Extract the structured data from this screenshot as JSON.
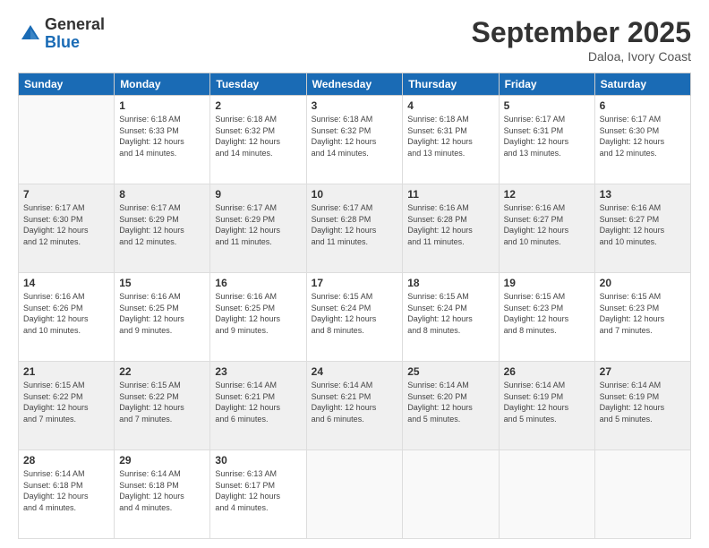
{
  "logo": {
    "general": "General",
    "blue": "Blue"
  },
  "header": {
    "title": "September 2025",
    "location": "Daloa, Ivory Coast"
  },
  "weekdays": [
    "Sunday",
    "Monday",
    "Tuesday",
    "Wednesday",
    "Thursday",
    "Friday",
    "Saturday"
  ],
  "weeks": [
    [
      {
        "day": "",
        "info": ""
      },
      {
        "day": "1",
        "info": "Sunrise: 6:18 AM\nSunset: 6:33 PM\nDaylight: 12 hours\nand 14 minutes."
      },
      {
        "day": "2",
        "info": "Sunrise: 6:18 AM\nSunset: 6:32 PM\nDaylight: 12 hours\nand 14 minutes."
      },
      {
        "day": "3",
        "info": "Sunrise: 6:18 AM\nSunset: 6:32 PM\nDaylight: 12 hours\nand 14 minutes."
      },
      {
        "day": "4",
        "info": "Sunrise: 6:18 AM\nSunset: 6:31 PM\nDaylight: 12 hours\nand 13 minutes."
      },
      {
        "day": "5",
        "info": "Sunrise: 6:17 AM\nSunset: 6:31 PM\nDaylight: 12 hours\nand 13 minutes."
      },
      {
        "day": "6",
        "info": "Sunrise: 6:17 AM\nSunset: 6:30 PM\nDaylight: 12 hours\nand 12 minutes."
      }
    ],
    [
      {
        "day": "7",
        "info": "Sunrise: 6:17 AM\nSunset: 6:30 PM\nDaylight: 12 hours\nand 12 minutes."
      },
      {
        "day": "8",
        "info": "Sunrise: 6:17 AM\nSunset: 6:29 PM\nDaylight: 12 hours\nand 12 minutes."
      },
      {
        "day": "9",
        "info": "Sunrise: 6:17 AM\nSunset: 6:29 PM\nDaylight: 12 hours\nand 11 minutes."
      },
      {
        "day": "10",
        "info": "Sunrise: 6:17 AM\nSunset: 6:28 PM\nDaylight: 12 hours\nand 11 minutes."
      },
      {
        "day": "11",
        "info": "Sunrise: 6:16 AM\nSunset: 6:28 PM\nDaylight: 12 hours\nand 11 minutes."
      },
      {
        "day": "12",
        "info": "Sunrise: 6:16 AM\nSunset: 6:27 PM\nDaylight: 12 hours\nand 10 minutes."
      },
      {
        "day": "13",
        "info": "Sunrise: 6:16 AM\nSunset: 6:27 PM\nDaylight: 12 hours\nand 10 minutes."
      }
    ],
    [
      {
        "day": "14",
        "info": "Sunrise: 6:16 AM\nSunset: 6:26 PM\nDaylight: 12 hours\nand 10 minutes."
      },
      {
        "day": "15",
        "info": "Sunrise: 6:16 AM\nSunset: 6:25 PM\nDaylight: 12 hours\nand 9 minutes."
      },
      {
        "day": "16",
        "info": "Sunrise: 6:16 AM\nSunset: 6:25 PM\nDaylight: 12 hours\nand 9 minutes."
      },
      {
        "day": "17",
        "info": "Sunrise: 6:15 AM\nSunset: 6:24 PM\nDaylight: 12 hours\nand 8 minutes."
      },
      {
        "day": "18",
        "info": "Sunrise: 6:15 AM\nSunset: 6:24 PM\nDaylight: 12 hours\nand 8 minutes."
      },
      {
        "day": "19",
        "info": "Sunrise: 6:15 AM\nSunset: 6:23 PM\nDaylight: 12 hours\nand 8 minutes."
      },
      {
        "day": "20",
        "info": "Sunrise: 6:15 AM\nSunset: 6:23 PM\nDaylight: 12 hours\nand 7 minutes."
      }
    ],
    [
      {
        "day": "21",
        "info": "Sunrise: 6:15 AM\nSunset: 6:22 PM\nDaylight: 12 hours\nand 7 minutes."
      },
      {
        "day": "22",
        "info": "Sunrise: 6:15 AM\nSunset: 6:22 PM\nDaylight: 12 hours\nand 7 minutes."
      },
      {
        "day": "23",
        "info": "Sunrise: 6:14 AM\nSunset: 6:21 PM\nDaylight: 12 hours\nand 6 minutes."
      },
      {
        "day": "24",
        "info": "Sunrise: 6:14 AM\nSunset: 6:21 PM\nDaylight: 12 hours\nand 6 minutes."
      },
      {
        "day": "25",
        "info": "Sunrise: 6:14 AM\nSunset: 6:20 PM\nDaylight: 12 hours\nand 5 minutes."
      },
      {
        "day": "26",
        "info": "Sunrise: 6:14 AM\nSunset: 6:19 PM\nDaylight: 12 hours\nand 5 minutes."
      },
      {
        "day": "27",
        "info": "Sunrise: 6:14 AM\nSunset: 6:19 PM\nDaylight: 12 hours\nand 5 minutes."
      }
    ],
    [
      {
        "day": "28",
        "info": "Sunrise: 6:14 AM\nSunset: 6:18 PM\nDaylight: 12 hours\nand 4 minutes."
      },
      {
        "day": "29",
        "info": "Sunrise: 6:14 AM\nSunset: 6:18 PM\nDaylight: 12 hours\nand 4 minutes."
      },
      {
        "day": "30",
        "info": "Sunrise: 6:13 AM\nSunset: 6:17 PM\nDaylight: 12 hours\nand 4 minutes."
      },
      {
        "day": "",
        "info": ""
      },
      {
        "day": "",
        "info": ""
      },
      {
        "day": "",
        "info": ""
      },
      {
        "day": "",
        "info": ""
      }
    ]
  ]
}
